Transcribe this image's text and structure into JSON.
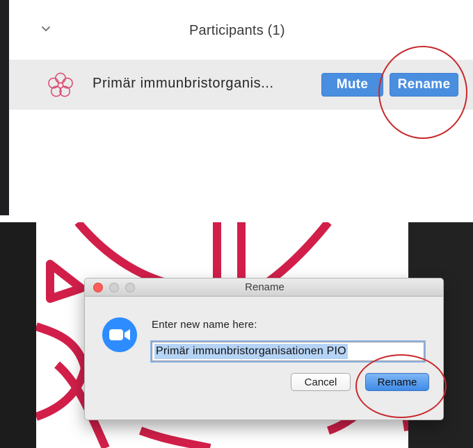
{
  "participants_panel": {
    "title": "Participants (1)",
    "participant": {
      "name": "Primär immunbristorganis...",
      "mute_label": "Mute",
      "rename_label": "Rename"
    }
  },
  "rename_dialog": {
    "title": "Rename",
    "prompt": "Enter new name here:",
    "input_value": "Primär immunbristorganisationen PIO",
    "cancel_label": "Cancel",
    "rename_label": "Rename"
  },
  "icons": {
    "collapse": "chevron-down-icon",
    "avatar": "flower-logo-icon",
    "app": "zoom-camera-icon"
  },
  "colors": {
    "button_blue": "#4a8ee0",
    "highlight_red": "#c8282b",
    "logo_red": "#d21f4a",
    "zoom_blue": "#2d8cff"
  }
}
